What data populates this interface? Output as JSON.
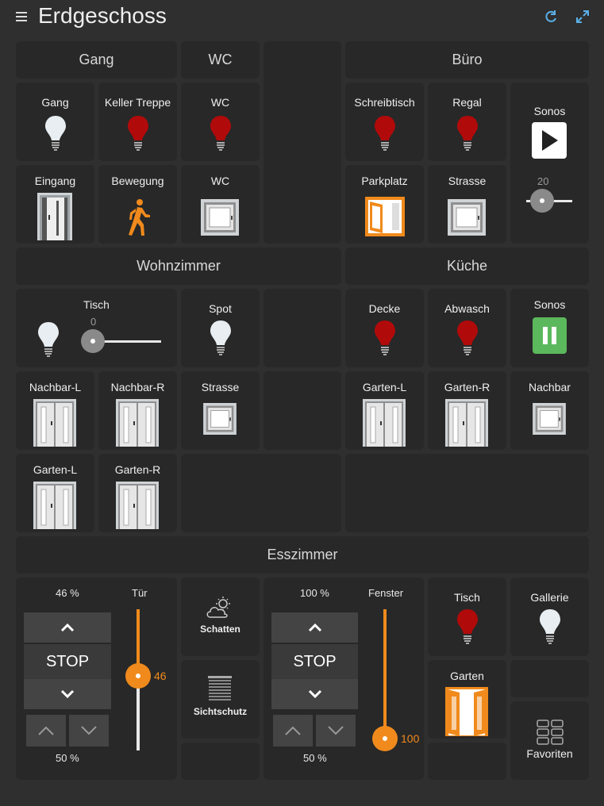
{
  "header": {
    "title": "Erdgeschoss",
    "menu_icon": "hamburger-menu-icon",
    "refresh_icon": "refresh-icon",
    "fullscreen_icon": "fullscreen-icon"
  },
  "colors": {
    "background": "#2f2f2f",
    "tile": "#282828",
    "accent": "#f08a1c",
    "bulb_on": "#b10a0a",
    "bulb_off": "#e8eef2",
    "green": "#5cb85c"
  },
  "sections": {
    "gang": "Gang",
    "wc": "WC",
    "buero": "Büro",
    "wohnzimmer": "Wohnzimmer",
    "kueche": "Küche",
    "esszimmer": "Esszimmer"
  },
  "gang": {
    "gang_light": "Gang",
    "keller_treppe": "Keller Treppe",
    "wc_light": "WC",
    "eingang": "Eingang",
    "bewegung": "Bewegung",
    "wc_window": "WC"
  },
  "buero": {
    "schreibtisch": "Schreibtisch",
    "regal": "Regal",
    "sonos": "Sonos",
    "sonos_volume": "20",
    "parkplatz": "Parkplatz",
    "strasse": "Strasse"
  },
  "wohnzimmer": {
    "tisch": "Tisch",
    "tisch_dim": "0",
    "spot": "Spot",
    "nachbar_l": "Nachbar-L",
    "nachbar_r": "Nachbar-R",
    "strasse": "Strasse",
    "garten_l": "Garten-L",
    "garten_r": "Garten-R"
  },
  "kueche": {
    "decke": "Decke",
    "abwasch": "Abwasch",
    "sonos": "Sonos",
    "garten_l": "Garten-L",
    "garten_r": "Garten-R",
    "nachbar": "Nachbar"
  },
  "esszimmer": {
    "blind1_pos": "46 %",
    "blind1_name": "Tür",
    "blind1_value": "46",
    "blind1_bottom": "50 %",
    "stop": "STOP",
    "schatten": "Schatten",
    "sichtschutz": "Sichtschutz",
    "blind2_pos": "100 %",
    "blind2_name": "Fenster",
    "blind2_value": "100",
    "blind2_bottom": "50 %",
    "tisch": "Tisch",
    "gallerie": "Gallerie",
    "garten": "Garten",
    "favoriten": "Favoriten"
  }
}
